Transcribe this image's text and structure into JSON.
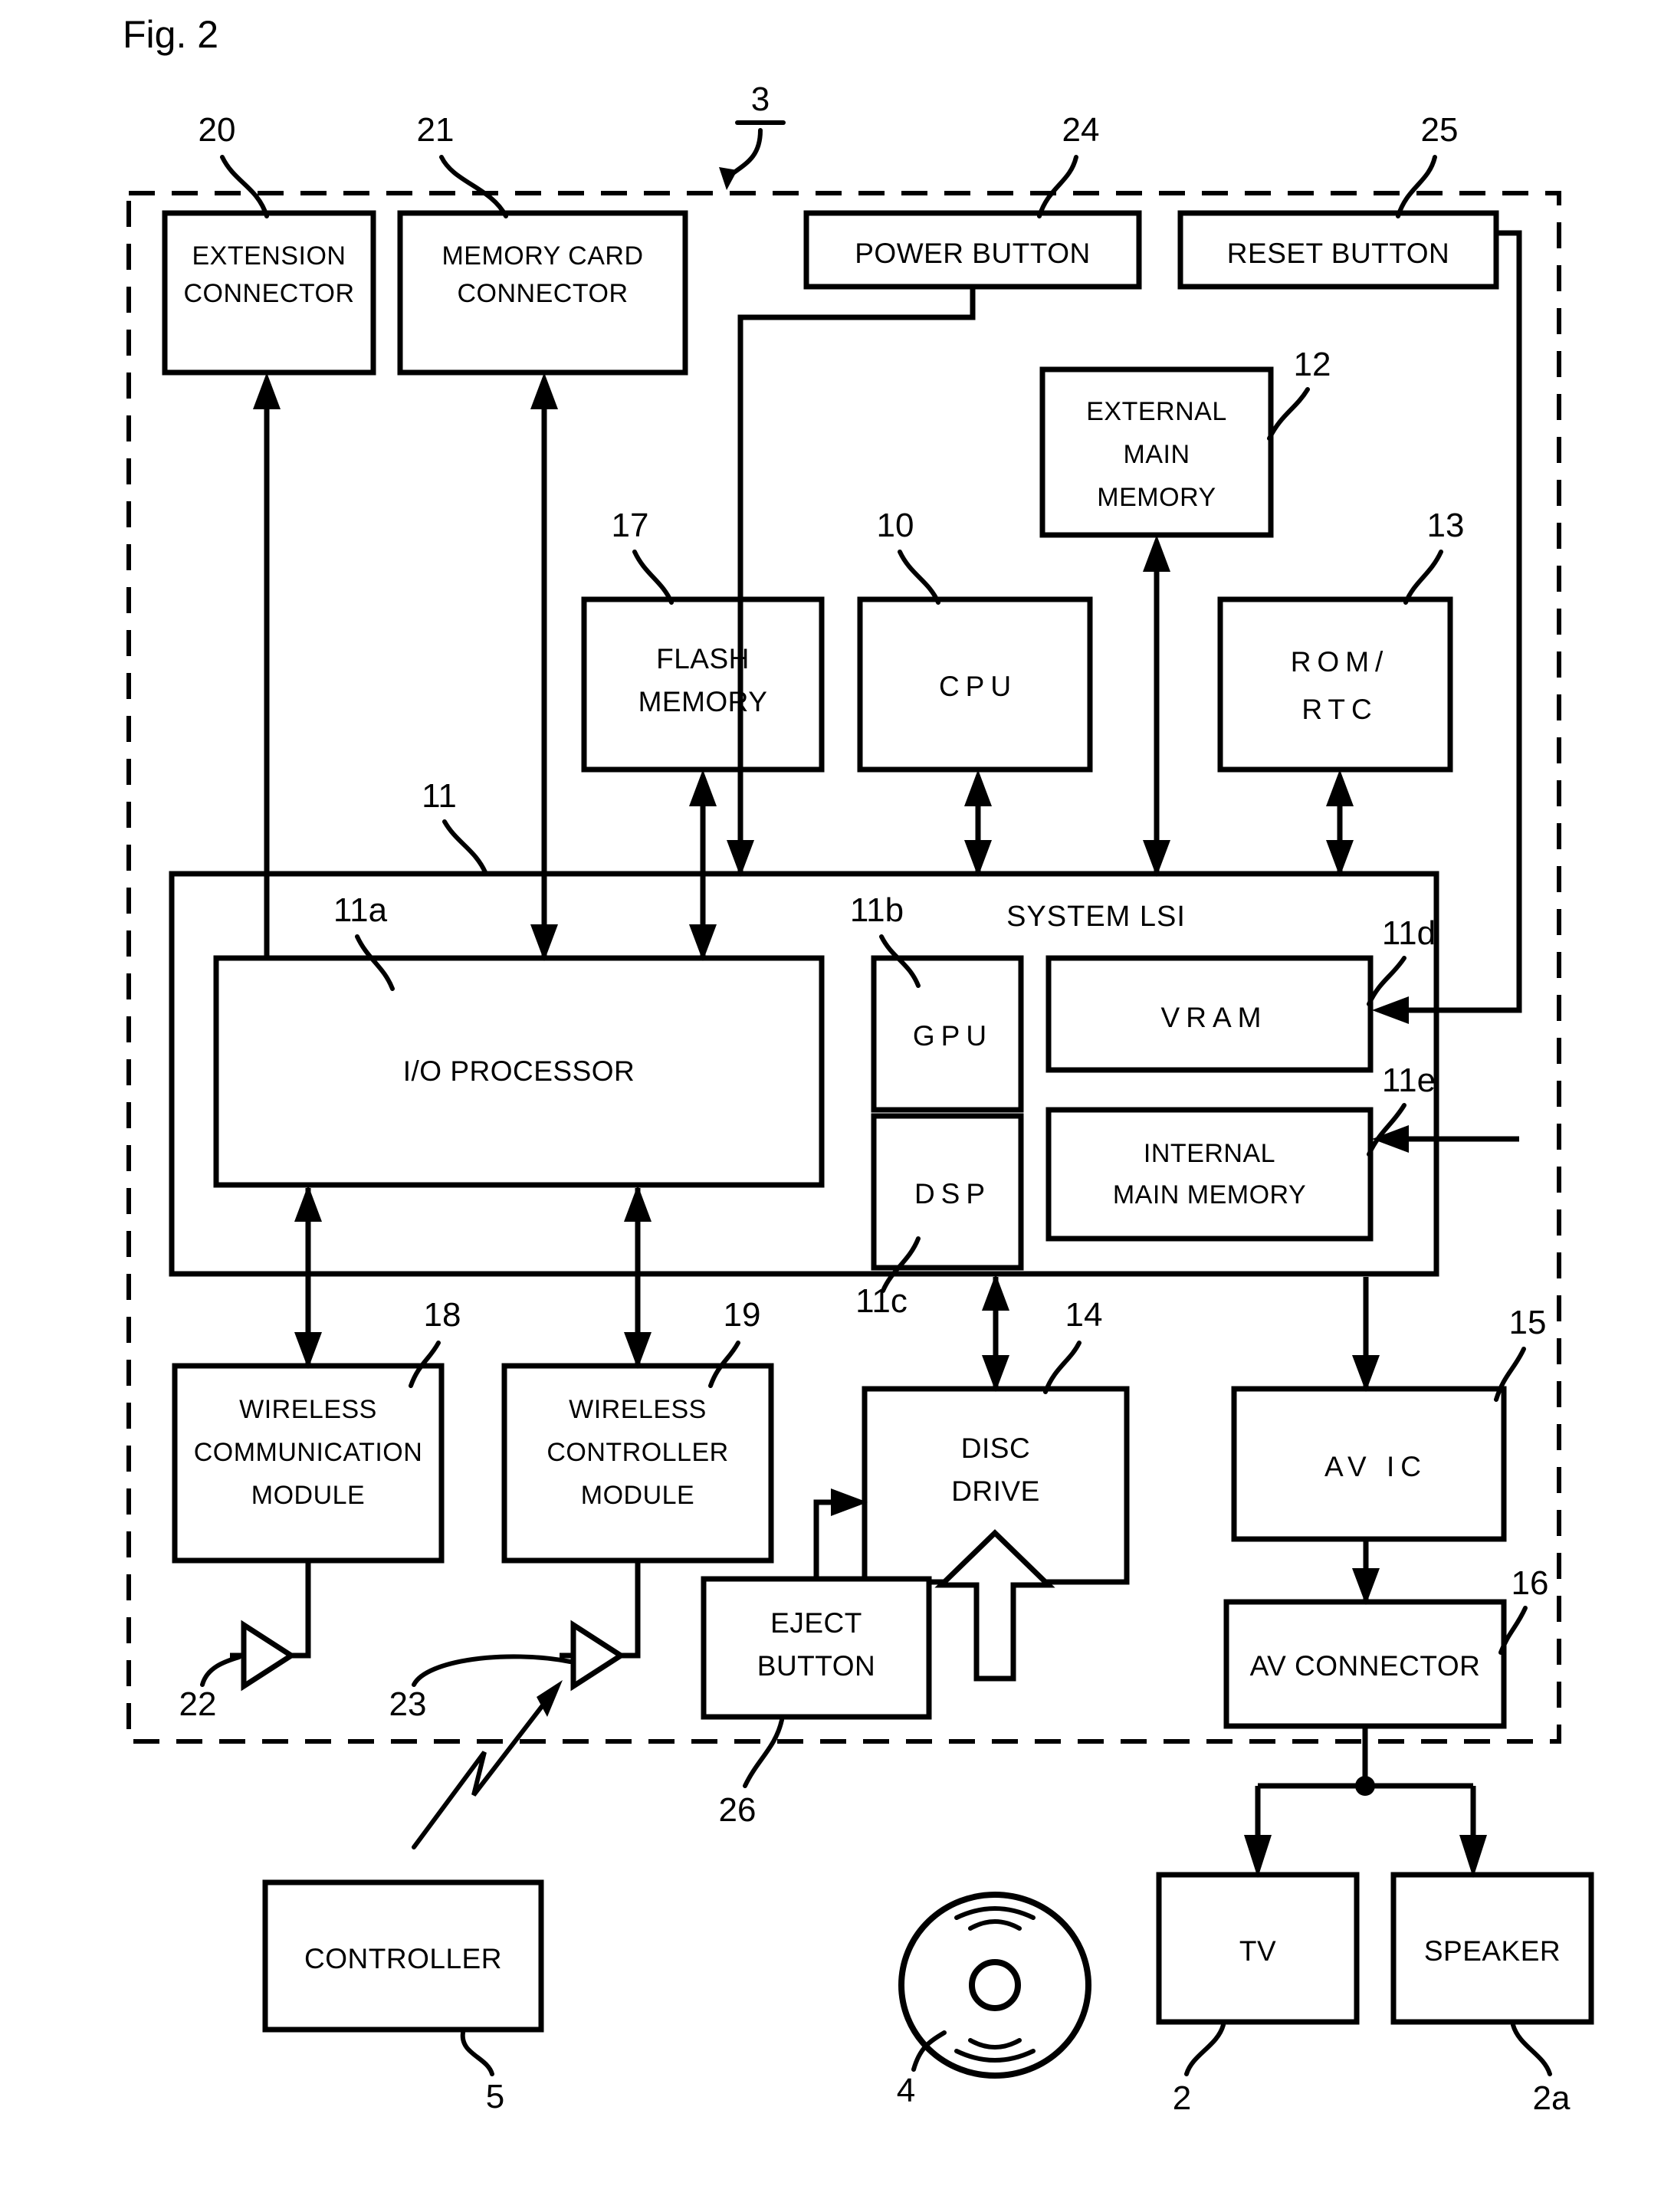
{
  "figure": {
    "title": "Fig. 2",
    "system_ref": "3"
  },
  "blocks": {
    "extension_connector": {
      "label_line1": "EXTENSION",
      "label_line2": "CONNECTOR",
      "ref": "20"
    },
    "memory_card_connector": {
      "label_line1": "MEMORY CARD",
      "label_line2": "CONNECTOR",
      "ref": "21"
    },
    "power_button": {
      "label": "POWER BUTTON",
      "ref": "24"
    },
    "reset_button": {
      "label": "RESET BUTTON",
      "ref": "25"
    },
    "external_main_memory": {
      "label_line1": "EXTERNAL",
      "label_line2": "MAIN",
      "label_line3": "MEMORY",
      "ref": "12"
    },
    "flash_memory": {
      "label_line1": "FLASH",
      "label_line2": "MEMORY",
      "ref": "17"
    },
    "cpu": {
      "label": "CPU",
      "ref": "10"
    },
    "rom_rtc": {
      "label_line1": "ROM/",
      "label_line2": "RTC",
      "ref": "13"
    },
    "system_lsi": {
      "label": "SYSTEM LSI",
      "ref": "11"
    },
    "io_processor": {
      "label": "I/O PROCESSOR",
      "ref": "11a"
    },
    "gpu": {
      "label": "GPU",
      "ref": "11b"
    },
    "dsp": {
      "label": "DSP",
      "ref": "11c"
    },
    "vram": {
      "label": "VRAM",
      "ref": "11d"
    },
    "internal_main_memory": {
      "label_line1": "INTERNAL",
      "label_line2": "MAIN MEMORY",
      "ref": "11e"
    },
    "wireless_communication_module": {
      "label_line1": "WIRELESS",
      "label_line2": "COMMUNICATION",
      "label_line3": "MODULE",
      "ref": "18"
    },
    "wireless_controller_module": {
      "label_line1": "WIRELESS",
      "label_line2": "CONTROLLER",
      "label_line3": "MODULE",
      "ref": "19"
    },
    "disc_drive": {
      "label_line1": "DISC",
      "label_line2": "DRIVE",
      "ref": "14"
    },
    "av_ic": {
      "label": "AV IC",
      "ref": "15"
    },
    "eject_button": {
      "label_line1": "EJECT",
      "label_line2": "BUTTON",
      "ref": "26"
    },
    "av_connector": {
      "label": "AV CONNECTOR",
      "ref": "16"
    },
    "controller": {
      "label": "CONTROLLER",
      "ref": "5"
    },
    "tv": {
      "label": "TV",
      "ref": "2"
    },
    "speaker": {
      "label": "SPEAKER",
      "ref": "2a"
    },
    "antenna_communication": {
      "ref": "22"
    },
    "antenna_controller": {
      "ref": "23"
    },
    "optical_disc": {
      "ref": "4"
    }
  },
  "colors": {
    "ink": "#000000",
    "paper": "#ffffff"
  }
}
